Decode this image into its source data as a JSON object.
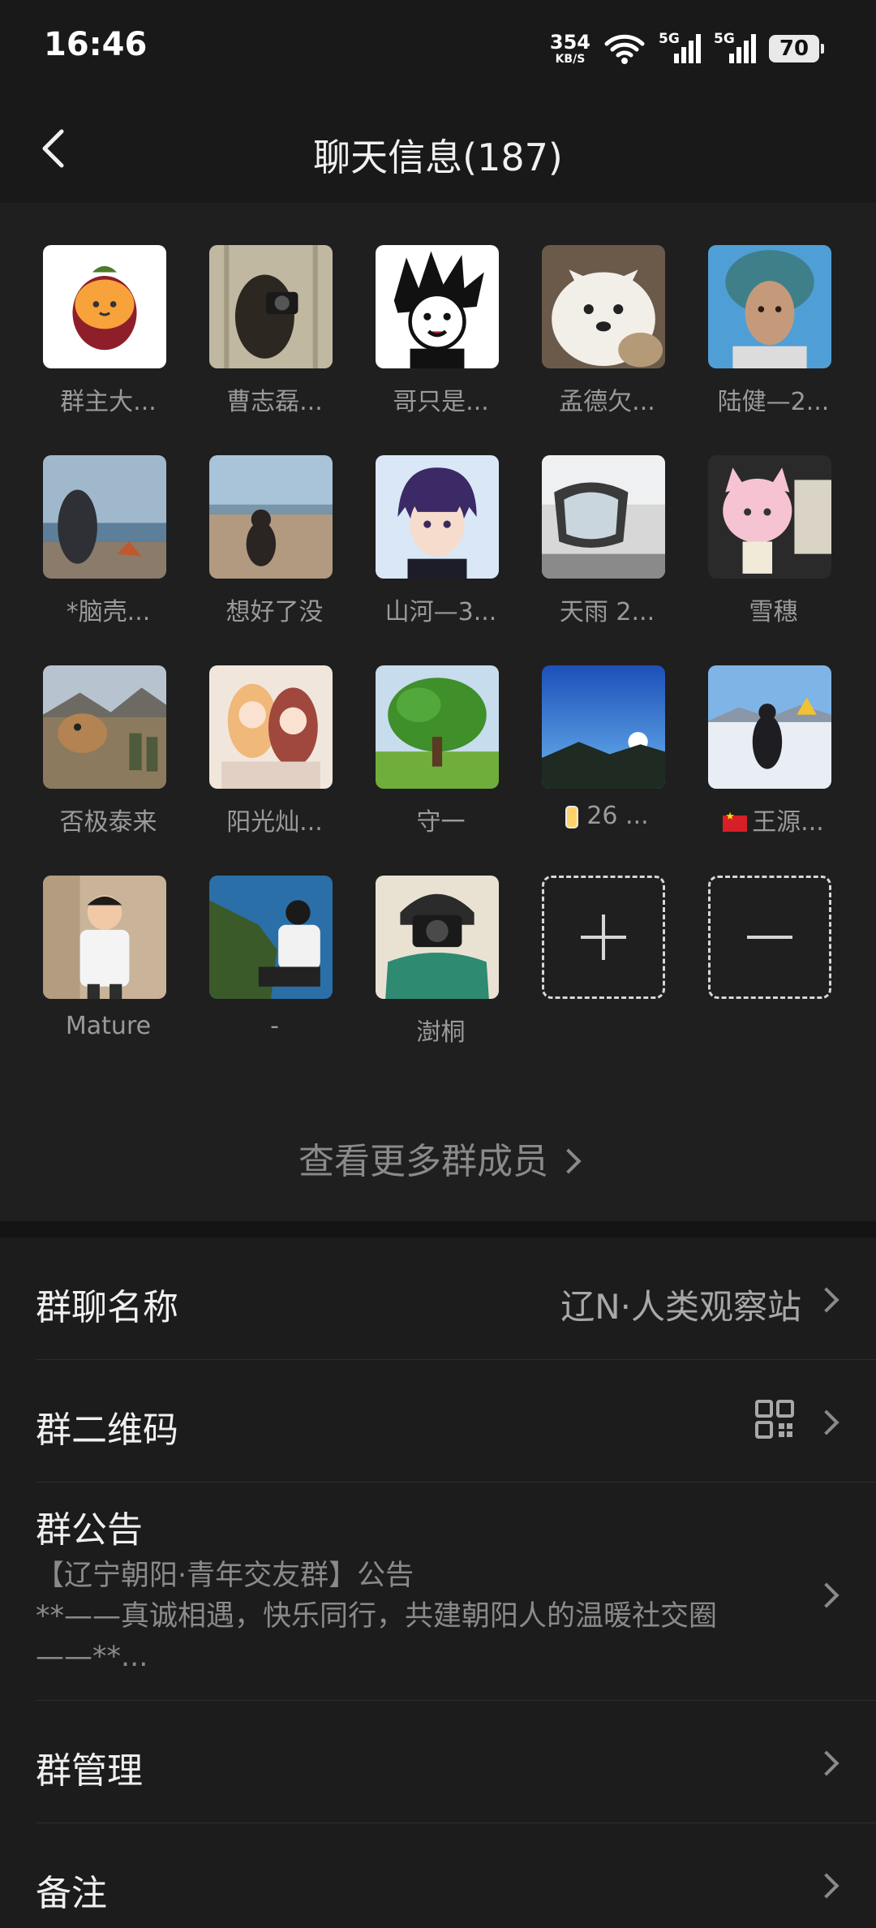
{
  "status_bar": {
    "time": "16:46",
    "net_speed": "354",
    "net_unit": "KB/S",
    "sim1_type": "5G",
    "sim2_type": "5G",
    "battery": "70"
  },
  "nav": {
    "title": "聊天信息(187)"
  },
  "members": [
    {
      "name": "群主大..."
    },
    {
      "name": "曹志磊..."
    },
    {
      "name": "哥只是..."
    },
    {
      "name": "孟德欠..."
    },
    {
      "name": "陆健—2..."
    },
    {
      "name": "*脑壳..."
    },
    {
      "name": "想好了没"
    },
    {
      "name": "山河—3..."
    },
    {
      "name": "天雨 2..."
    },
    {
      "name": "雪穗"
    },
    {
      "name": "否极泰来"
    },
    {
      "name": "阳光灿..."
    },
    {
      "name": "守一"
    },
    {
      "name": "26 ..."
    },
    {
      "name": "王源..."
    },
    {
      "name": "Mature"
    },
    {
      "name": "-"
    },
    {
      "name": "澍桐"
    }
  ],
  "view_more": "查看更多群成员",
  "settings": {
    "group_name_label": "群聊名称",
    "group_name_value": "辽N·人类观察站",
    "qr_label": "群二维码",
    "notice_label": "群公告",
    "notice_line1": "【辽宁朝阳·青年交友群】公告",
    "notice_line2": "**——真诚相遇，快乐同行，共建朝阳人的温暖社交圈",
    "notice_line3": "——**...",
    "manage_label": "群管理",
    "remark_label": "备注"
  },
  "colors": {
    "background": "#191919",
    "panel": "#1f1f1f",
    "text": "#f0f0f0",
    "muted": "#9a9a9a"
  }
}
